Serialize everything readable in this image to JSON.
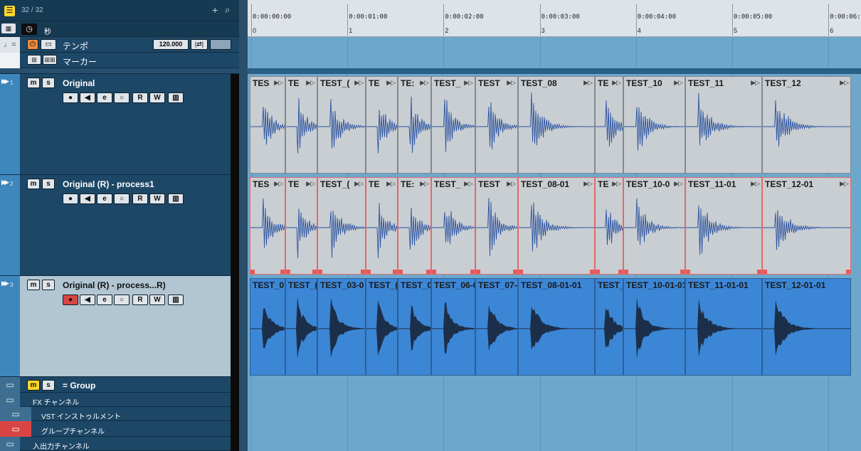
{
  "colors": {
    "accent": "#f08a3c",
    "group_yellow": "#ffd52b",
    "selected_track": "#b1c6d2",
    "rec_red": "#d94545",
    "event_gray": "#c9ced2",
    "event_blue": "#3c86d6"
  },
  "header": {
    "count": "32 / 32",
    "add_icon": "plus-icon",
    "search_icon": "magnifier-icon"
  },
  "ruler": {
    "time_unit": "秒",
    "times": [
      "0:00:00:00",
      "0:00:01:00",
      "0:00:02:00",
      "0:00:03:00",
      "0:00:04:00",
      "0:00:05:00",
      "0:00:06:00"
    ],
    "bars": [
      "0",
      "1",
      "2",
      "3",
      "4",
      "5",
      "6"
    ]
  },
  "tempo_track": {
    "label": "テンポ",
    "value": "120.000"
  },
  "marker_track": {
    "label": "マーカー"
  },
  "tracks": [
    {
      "number": "1",
      "name": "Original",
      "m": "m",
      "s": "s",
      "r": "R",
      "w": "W",
      "events": [
        "TES",
        "TE",
        "TEST_(",
        "TE",
        "TE:",
        "TEST_",
        "TEST",
        "TEST_08",
        "TE",
        "TEST_10",
        "TEST_11",
        "TEST_12"
      ]
    },
    {
      "number": "2",
      "name": "Original (R) - process1",
      "m": "m",
      "s": "s",
      "r": "R",
      "w": "W",
      "events": [
        "TES",
        "TE",
        "TEST_(",
        "TE",
        "TE:",
        "TEST_",
        "TEST",
        "TEST_08-01",
        "TE",
        "TEST_10-0",
        "TEST_11-01",
        "TEST_12-01"
      ]
    },
    {
      "number": "3",
      "name": "Original (R) - process...R)",
      "m": "m",
      "s": "s",
      "r": "R",
      "w": "W",
      "events": [
        "TEST_0",
        "TEST_(",
        "TEST_03-0",
        "TEST_(",
        "TEST_0",
        "TEST_06-0",
        "TEST_07-",
        "TEST_08-01-01",
        "TEST_",
        "TEST_10-01-01",
        "TEST_11-01-01",
        "TEST_12-01-01"
      ]
    }
  ],
  "folders": {
    "group": "= Group",
    "m": "m",
    "s": "s",
    "fx": "FX チャンネル",
    "vst": "VST インストゥルメント",
    "grp": "グループチャンネル",
    "io": "入出力チャンネル"
  }
}
